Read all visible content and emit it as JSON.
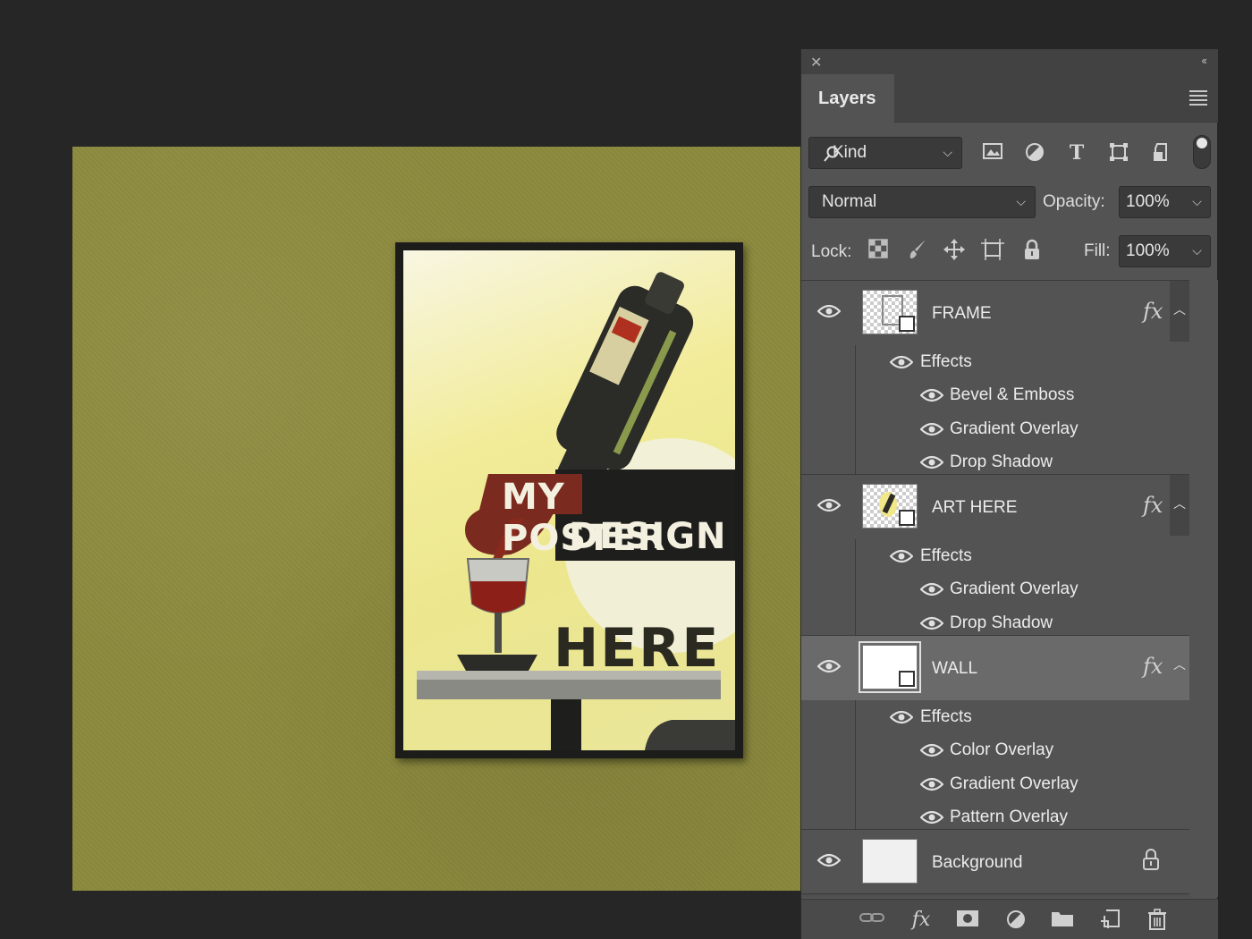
{
  "poster": {
    "line1": "MY POSTER",
    "line2": "DESIGN",
    "line3": "HERE"
  },
  "panel": {
    "tab": "Layers",
    "filter": {
      "kind_label": "Kind",
      "icons": [
        "image-filter-icon",
        "adjustment-filter-icon",
        "type-filter-icon",
        "shape-filter-icon",
        "smart-object-filter-icon"
      ]
    },
    "blend_mode": "Normal",
    "opacity_label": "Opacity:",
    "opacity_value": "100%",
    "lock_label": "Lock:",
    "fill_label": "Fill:",
    "fill_value": "100%",
    "layers": [
      {
        "name": "FRAME",
        "fx": "fx",
        "effects_label": "Effects",
        "effects": [
          "Bevel & Emboss",
          "Gradient Overlay",
          "Drop Shadow"
        ]
      },
      {
        "name": "ART HERE",
        "fx": "fx",
        "effects_label": "Effects",
        "effects": [
          "Gradient Overlay",
          "Drop Shadow"
        ]
      },
      {
        "name": "WALL",
        "fx": "fx",
        "selected": true,
        "effects_label": "Effects",
        "effects": [
          "Color Overlay",
          "Gradient Overlay",
          "Pattern Overlay"
        ]
      },
      {
        "name": "Background",
        "locked": true
      }
    ],
    "bottom_icons": [
      "link-layers-icon",
      "add-style-icon",
      "add-mask-icon",
      "adjustment-layer-icon",
      "new-group-icon",
      "new-layer-icon",
      "delete-layer-icon"
    ]
  },
  "colors": {
    "wall": "#8c8a3d",
    "panel": "#535353",
    "selected_row": "#6a6a6a",
    "app_bg": "#262626"
  }
}
